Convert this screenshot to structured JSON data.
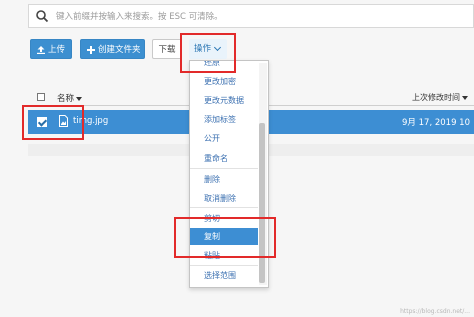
{
  "search": {
    "placeholder": "键入前缀并按输入来搜索。按 ESC 可清除。"
  },
  "toolbar": {
    "upload_label": "上传",
    "create_folder_label": "创建文件夹",
    "download_label": "下载",
    "actions_label": "操作"
  },
  "table": {
    "columns": {
      "name": "名称",
      "last_modified": "上次修改时间"
    },
    "rows": [
      {
        "name": "timg.jpg",
        "last_modified": "9月 17, 2019 10",
        "selected": true
      }
    ]
  },
  "menu": {
    "items": [
      {
        "label": "还原"
      },
      {
        "label": "更改加密"
      },
      {
        "label": "更改元数据"
      },
      {
        "label": "添加标签"
      },
      {
        "label": "公开"
      },
      {
        "label": "重命名"
      },
      {
        "label": "删除"
      },
      {
        "label": "取消删除"
      },
      {
        "label": "剪切"
      },
      {
        "label": "复制",
        "active": true
      },
      {
        "label": "粘贴"
      },
      {
        "label": "选择范围"
      }
    ]
  },
  "watermark": "https://blog.csdn.net/...",
  "colors": {
    "accent": "#3d8ed3",
    "highlight": "#e22a2a"
  }
}
